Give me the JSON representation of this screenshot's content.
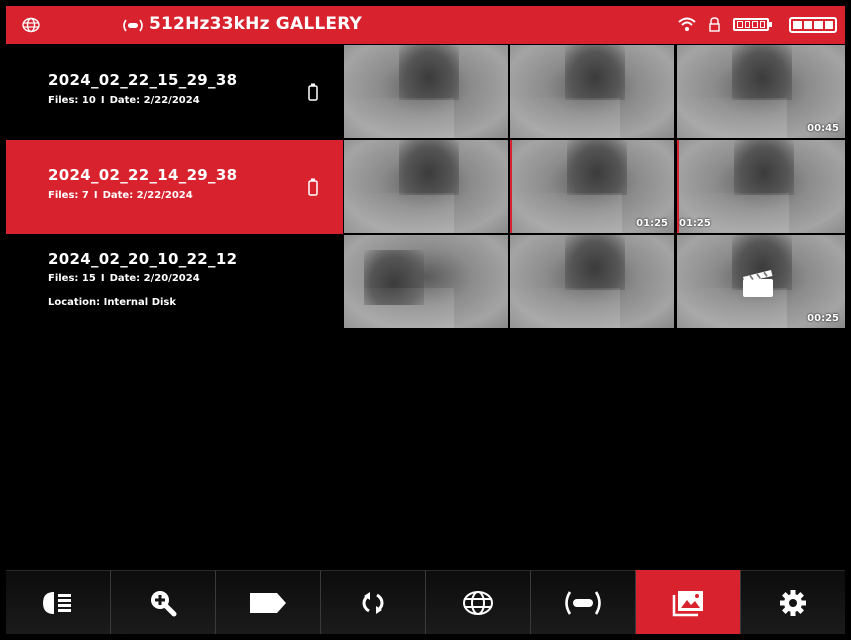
{
  "header": {
    "title": "512Hz33kHz GALLERY",
    "icons": [
      "grid-logo-icon",
      "signal-icon",
      "wifi-icon",
      "lock-icon",
      "battery-small-icon",
      "battery-large-icon"
    ]
  },
  "colors": {
    "accent": "#d8232f",
    "background": "#000000",
    "text": "#ffffff"
  },
  "sessions": [
    {
      "name": "2024_02_22_15_29_38",
      "files_label": "Files: 10",
      "date_label": "Date: 2/22/2024",
      "separator": "I",
      "location": ""
    },
    {
      "name": "2024_02_22_14_29_38",
      "files_label": "Files: 7",
      "date_label": "Date: 2/22/2024",
      "separator": "I",
      "location": ""
    },
    {
      "name": "2024_02_20_10_22_12",
      "files_label": "Files: 15",
      "date_label": "Date: 2/20/2024",
      "separator": "I",
      "location": "Location: Internal Disk"
    }
  ],
  "thumbnails": {
    "row0": [
      "",
      "",
      "00:45"
    ],
    "row1": [
      "",
      "01:25",
      "01:25"
    ],
    "row2": [
      "",
      "",
      "00:25"
    ]
  },
  "toolbar": {
    "items": [
      "light-icon",
      "zoom-in-icon",
      "tag-icon",
      "refresh-icon",
      "grid-icon",
      "signal-icon",
      "gallery-icon",
      "settings-icon"
    ],
    "active": "gallery-icon"
  }
}
